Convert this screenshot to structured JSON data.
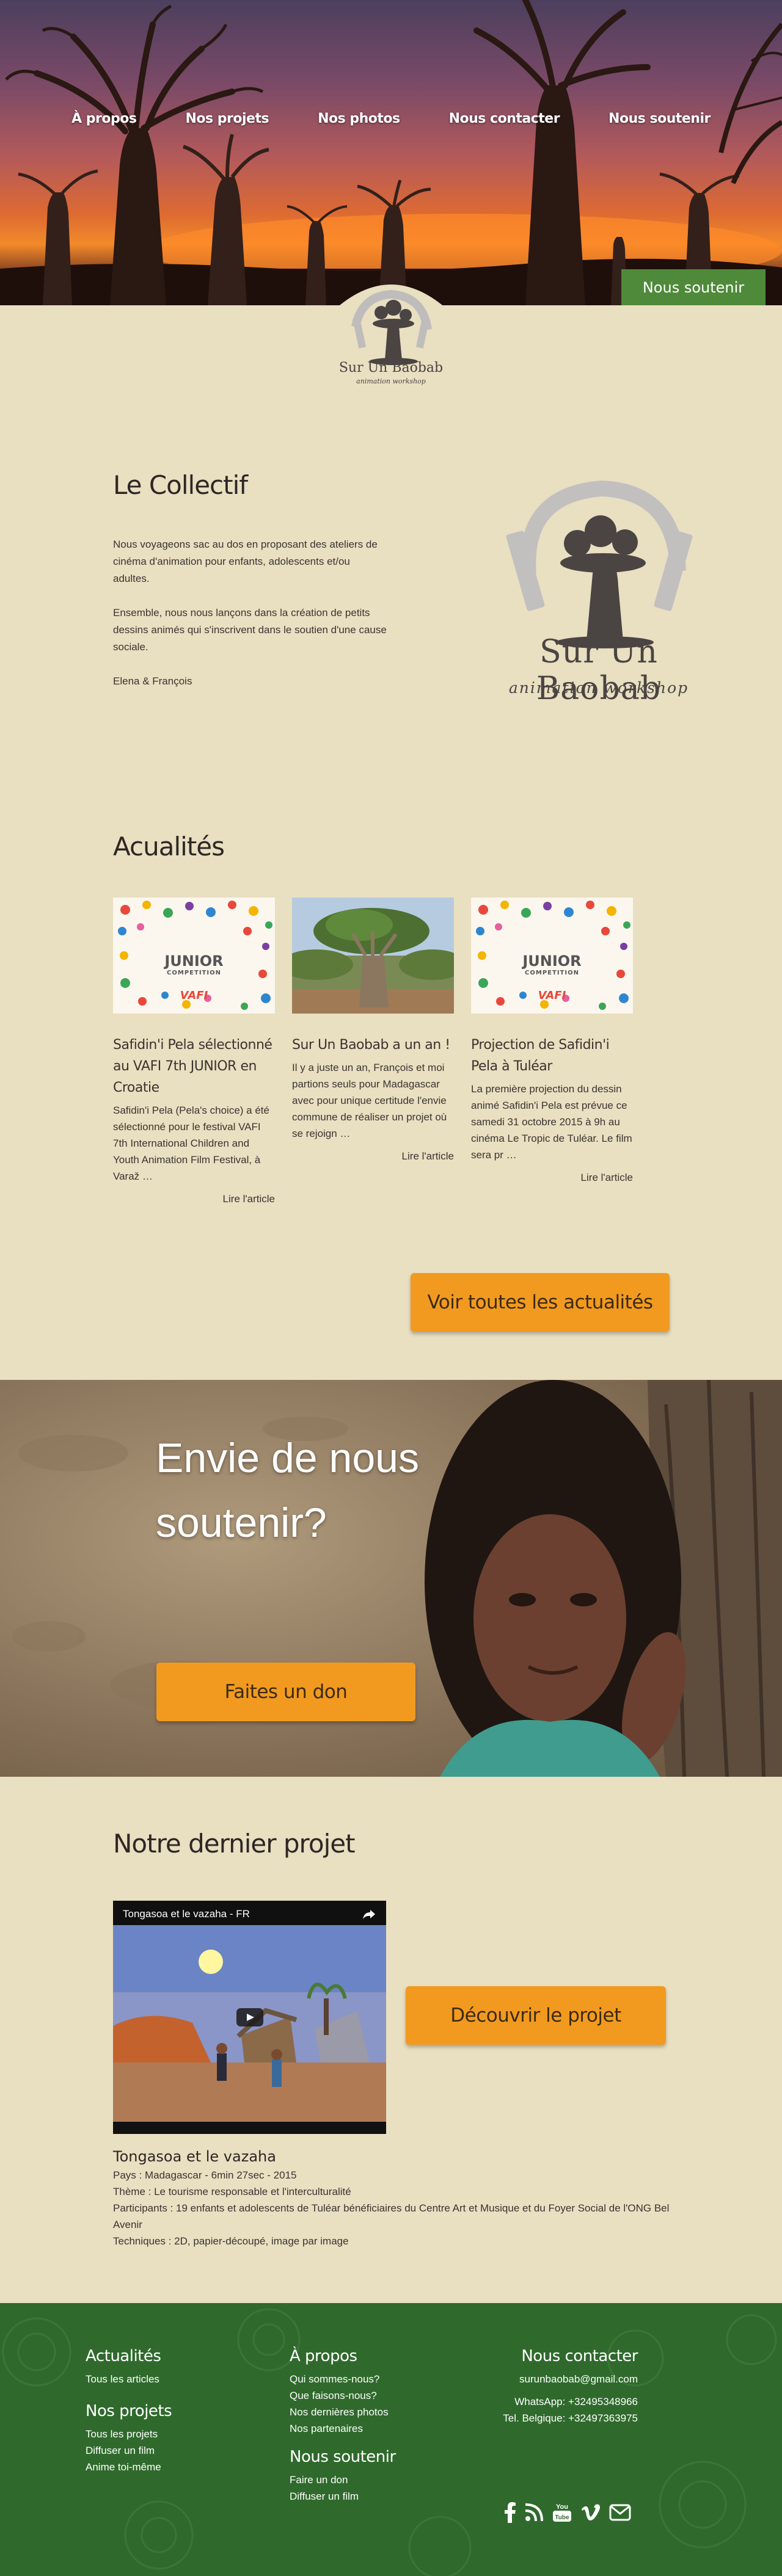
{
  "nav": {
    "items": [
      "À propos",
      "Nos projets",
      "Nos photos",
      "Nous contacter",
      "Nous soutenir"
    ]
  },
  "hero": {
    "support_button": "Nous soutenir"
  },
  "logo": {
    "name": "Sur Un Baobab",
    "tagline": "animation workshop"
  },
  "collectif": {
    "title": "Le Collectif",
    "paragraphs": [
      "Nous voyageons sac au dos en proposant des ateliers de cinéma d'animation pour enfants, adolescents et/ou adultes.",
      "Ensemble, nous nous lançons dans la création de petits dessins animés qui s'inscrivent dans le soutien d'une cause sociale.",
      "Elena & François"
    ]
  },
  "news": {
    "title": "Acualités",
    "cards": [
      {
        "title": "Safidin'i Pela sélectionné au VAFI 7th JUNIOR en Croatie",
        "excerpt": "Safidin'i Pela (Pela's choice) a été sélectionné pour le festival VAFI 7th International Children and Youth Animation Film Festival, à Varaž …",
        "more": "Lire l'article",
        "image_label": "JUNIOR",
        "image_sublabel": "COMPETITION",
        "image_logo": "VAFI"
      },
      {
        "title": "Sur Un Baobab a un an !",
        "excerpt": "Il y a juste un an, François et moi partions seuls pour Madagascar avec pour unique certitude l'envie commune de réaliser un projet où se rejoign …",
        "more": "Lire l'article"
      },
      {
        "title": "Projection de Safidin'i Pela à Tuléar",
        "excerpt": "La première projection du dessin animé Safidin'i Pela est prévue ce samedi 31 octobre 2015 à 9h au cinéma Le Tropic de Tuléar. Le film sera pr …",
        "more": "Lire l'article",
        "image_label": "JUNIOR",
        "image_sublabel": "COMPETITION",
        "image_logo": "VAFI"
      }
    ],
    "all_button": "Voir toutes les actualités"
  },
  "support": {
    "heading": "Envie de nous soutenir?",
    "donate_button": "Faites un don"
  },
  "project": {
    "title": "Notre dernier projet",
    "video_title": "Tongasoa et le vazaha - FR",
    "discover_button": "Découvrir le projet",
    "name": "Tongasoa et le vazaha",
    "lines": [
      "Pays : Madagascar - 6min 27sec - 2015",
      "Thème : Le tourisme responsable et l'interculturalité",
      "Participants : 19 enfants et adolescents de Tuléar bénéficiaires du Centre Art et Musique et du Foyer Social de l'ONG Bel Avenir",
      "Techniques : 2D, papier-découpé, image par image"
    ]
  },
  "footer": {
    "news": {
      "title": "Actualités",
      "links": [
        "Tous les articles"
      ]
    },
    "projects": {
      "title": "Nos projets",
      "links": [
        "Tous les projets",
        "Diffuser un film",
        "Anime toi-même"
      ]
    },
    "about": {
      "title": "À propos",
      "links": [
        "Qui sommes-nous?",
        "Que faisons-nous?",
        "Nos dernières photos",
        "Nos partenaires"
      ]
    },
    "support": {
      "title": "Nous soutenir",
      "links": [
        "Faire un don",
        "Diffuser un film"
      ]
    },
    "contact": {
      "title": "Nous contacter",
      "email": "surunbaobab@gmail.com",
      "whatsapp": "WhatsApp: +32495348966",
      "phone": "Tel. Belgique: +32497363975"
    },
    "social_icons": [
      "facebook-icon",
      "rss-icon",
      "youtube-icon",
      "vimeo-icon",
      "mail-icon"
    ]
  },
  "colors": {
    "beige": "#e9dfc1",
    "green": "#2f6a2c",
    "orange": "#f29a1f",
    "button_green": "#4f8a3a"
  }
}
